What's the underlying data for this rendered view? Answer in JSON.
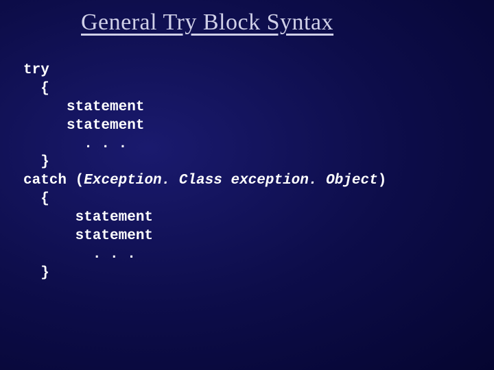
{
  "title": " General Try Block Syntax",
  "code": {
    "l1": "try",
    "l2": "  {",
    "l3": "     statement",
    "l4": "     statement",
    "l5": "       . . .",
    "l6": "  }",
    "l7a": "catch ",
    "l7b": "(",
    "l7c": "Exception. Class exception. Object",
    "l7d": ")",
    "l8": "  {",
    "l9": "      statement",
    "l10": "      statement",
    "l11": "        . . .",
    "l12": "  }"
  }
}
